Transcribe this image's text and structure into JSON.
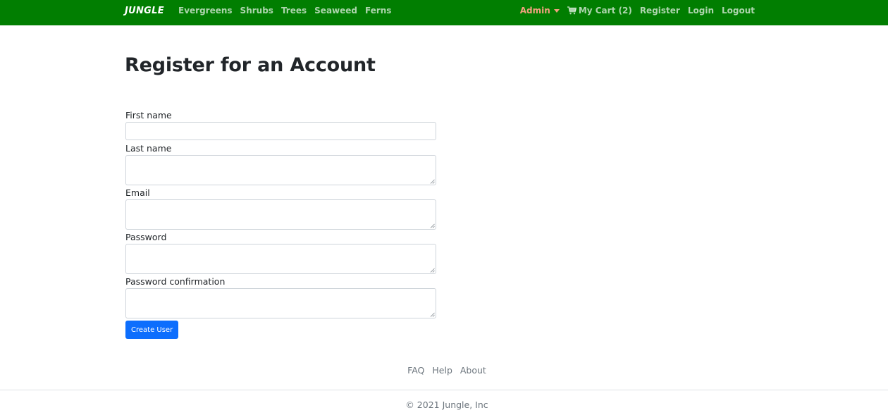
{
  "nav": {
    "brand": "JUNGLE",
    "categories": [
      {
        "label": "Evergreens"
      },
      {
        "label": "Shrubs"
      },
      {
        "label": "Trees"
      },
      {
        "label": "Seaweed"
      },
      {
        "label": "Ferns"
      }
    ],
    "admin_label": "Admin",
    "cart_label": "My Cart (2)",
    "cart_icon": "shopping-cart-icon",
    "register_label": "Register",
    "login_label": "Login",
    "logout_label": "Logout",
    "colors": {
      "navbar": "#017e01",
      "admin": "#f0a27e"
    }
  },
  "page": {
    "title": "Register for an Account"
  },
  "form": {
    "fields": [
      {
        "label": "First name",
        "value": ""
      },
      {
        "label": "Last name",
        "value": ""
      },
      {
        "label": "Email",
        "value": ""
      },
      {
        "label": "Password",
        "value": ""
      },
      {
        "label": "Password confirmation",
        "value": ""
      }
    ],
    "submit_label": "Create User",
    "submit_color": "#0d6efd"
  },
  "footer": {
    "links": [
      {
        "label": "FAQ"
      },
      {
        "label": "Help"
      },
      {
        "label": "About"
      }
    ],
    "copyright": "© 2021 Jungle, Inc"
  }
}
